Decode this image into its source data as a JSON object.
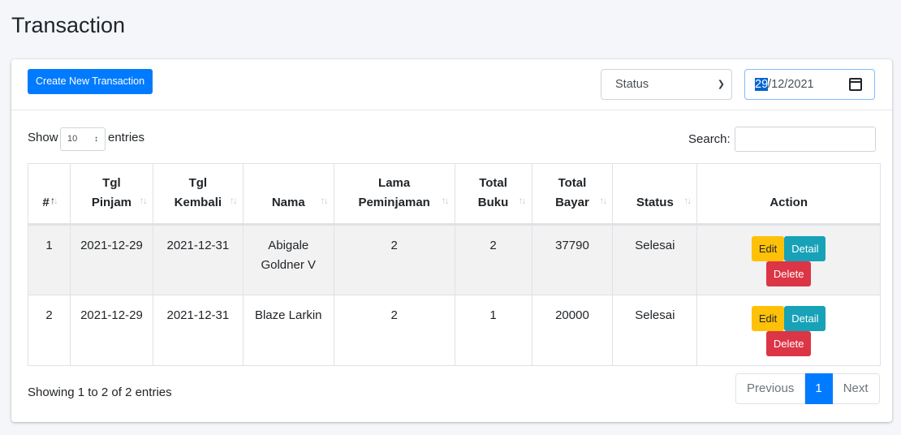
{
  "page": {
    "title": "Transaction"
  },
  "header": {
    "create_button": "Create New Transaction",
    "status_select": "Status",
    "date_value_day": "29",
    "date_value_rest": "/12/2021"
  },
  "controls": {
    "show_label": "Show",
    "length_value": "10",
    "entries_label": "entries",
    "search_label": "Search:"
  },
  "table": {
    "columns": [
      {
        "line1": "#",
        "line2": ""
      },
      {
        "line1": "Tgl",
        "line2": "Pinjam"
      },
      {
        "line1": "Tgl",
        "line2": "Kembali"
      },
      {
        "line1": "Nama",
        "line2": ""
      },
      {
        "line1": "Lama",
        "line2": "Peminjaman"
      },
      {
        "line1": "Total",
        "line2": "Buku"
      },
      {
        "line1": "Total",
        "line2": "Bayar"
      },
      {
        "line1": "Status",
        "line2": ""
      },
      {
        "line1": "Action",
        "line2": ""
      }
    ],
    "rows": [
      {
        "no": "1",
        "tgl_pinjam": "2021-12-29",
        "tgl_kembali": "2021-12-31",
        "nama_1": "Abigale",
        "nama_2": "Goldner V",
        "lama": "2",
        "total_buku": "2",
        "total_bayar": "37790",
        "status": "Selesai"
      },
      {
        "no": "2",
        "tgl_pinjam": "2021-12-29",
        "tgl_kembali": "2021-12-31",
        "nama_1": "Blaze Larkin",
        "nama_2": "",
        "lama": "2",
        "total_buku": "1",
        "total_bayar": "20000",
        "status": "Selesai"
      }
    ],
    "actions": {
      "edit": "Edit",
      "detail": "Detail",
      "delete": "Delete"
    }
  },
  "footer": {
    "info": "Showing 1 to 2 of 2 entries",
    "previous": "Previous",
    "current_page": "1",
    "next": "Next"
  },
  "colors": {
    "primary": "#007bff",
    "warning": "#ffc107",
    "info": "#17a2b8",
    "danger": "#dc3545",
    "background": "#f4f6f9"
  }
}
